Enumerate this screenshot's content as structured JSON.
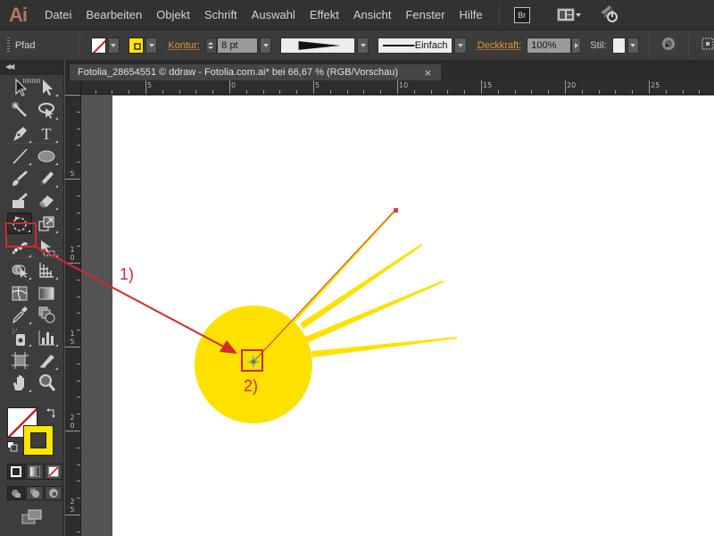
{
  "app": {
    "logo": "Ai",
    "menu": [
      "Datei",
      "Bearbeiten",
      "Objekt",
      "Schrift",
      "Auswahl",
      "Effekt",
      "Ansicht",
      "Fenster",
      "Hilfe"
    ],
    "bridge_label": "Br",
    "icons": {
      "workspace_layout": "layout-grid-icon",
      "sync": "creative-cloud-sync-icon"
    }
  },
  "control_bar": {
    "selection_type": "Pfad",
    "fill": {
      "state": "none",
      "icon": "no-fill-swatch-icon"
    },
    "stroke": {
      "color": "#ffe600",
      "icon": "stroke-swatch-icon"
    },
    "stroke_label": "Kontur:",
    "stroke_weight": "8 pt",
    "variable_width_profile": "tapered-stroke-profile",
    "brush_label": "Einfach",
    "opacity_label": "Deckkraft:",
    "opacity_value": "100%",
    "style_label": "Stil:",
    "icons": [
      "recolor-artwork-icon",
      "isolate-selection-icon"
    ]
  },
  "toolbar": {
    "tools": [
      {
        "name": "selection-tool",
        "icon": "selection-arrow-icon"
      },
      {
        "name": "direct-selection-tool",
        "icon": "direct-selection-arrow-icon"
      },
      {
        "name": "magic-wand-tool",
        "icon": "magic-wand-icon"
      },
      {
        "name": "lasso-tool",
        "icon": "lasso-icon"
      },
      {
        "name": "pen-tool",
        "icon": "pen-icon"
      },
      {
        "name": "type-tool",
        "icon": "type-icon"
      },
      {
        "name": "line-segment-tool",
        "icon": "line-icon"
      },
      {
        "name": "ellipse-tool",
        "icon": "ellipse-icon"
      },
      {
        "name": "paintbrush-tool",
        "icon": "paintbrush-icon"
      },
      {
        "name": "pencil-tool",
        "icon": "pencil-icon"
      },
      {
        "name": "blob-brush-tool",
        "icon": "blob-brush-icon"
      },
      {
        "name": "eraser-tool",
        "icon": "eraser-icon"
      },
      {
        "name": "rotate-tool",
        "icon": "rotate-icon",
        "selected": true
      },
      {
        "name": "scale-tool",
        "icon": "scale-icon"
      },
      {
        "name": "puppet-warp-tool",
        "icon": "puppet-warp-icon"
      },
      {
        "name": "free-transform-tool",
        "icon": "free-transform-icon"
      },
      {
        "name": "shape-builder-tool",
        "icon": "shape-builder-icon"
      },
      {
        "name": "perspective-grid-tool",
        "icon": "perspective-grid-icon"
      },
      {
        "name": "mesh-tool",
        "icon": "mesh-icon"
      },
      {
        "name": "gradient-tool",
        "icon": "gradient-icon"
      },
      {
        "name": "eyedropper-tool",
        "icon": "eyedropper-icon"
      },
      {
        "name": "blend-tool",
        "icon": "blend-icon"
      },
      {
        "name": "symbol-sprayer-tool",
        "icon": "symbol-sprayer-icon"
      },
      {
        "name": "column-graph-tool",
        "icon": "column-graph-icon"
      },
      {
        "name": "artboard-tool",
        "icon": "artboard-icon"
      },
      {
        "name": "slice-tool",
        "icon": "slice-icon"
      },
      {
        "name": "hand-tool",
        "icon": "hand-icon"
      },
      {
        "name": "zoom-tool",
        "icon": "zoom-icon"
      }
    ],
    "fill_stroke": {
      "fill": "none",
      "stroke_color": "#ffe600"
    },
    "color_modes": [
      "color",
      "gradient",
      "none"
    ],
    "draw_modes": [
      "draw-normal",
      "draw-behind",
      "draw-inside"
    ],
    "screen_mode": "change-screen-mode-icon"
  },
  "document": {
    "tab_title": "Fotolia_28654551 © ddraw - Fotolia.com.ai* bei 66,67 % (RGB/Vorschau)",
    "close_glyph": "×",
    "hruler_labels": [
      "5",
      "0",
      "5",
      "10",
      "15",
      "20",
      "25"
    ],
    "vruler_labels": [
      "5",
      "10",
      "15",
      "20",
      "25"
    ]
  },
  "artwork": {
    "sun_color": "#ffe100",
    "path_color": "#c0392b",
    "annotations": [
      {
        "label": "1)",
        "target": "rotate-tool"
      },
      {
        "label": "2)",
        "target": "rotation-origin-point"
      }
    ],
    "annotation_color": "#d9262a"
  }
}
